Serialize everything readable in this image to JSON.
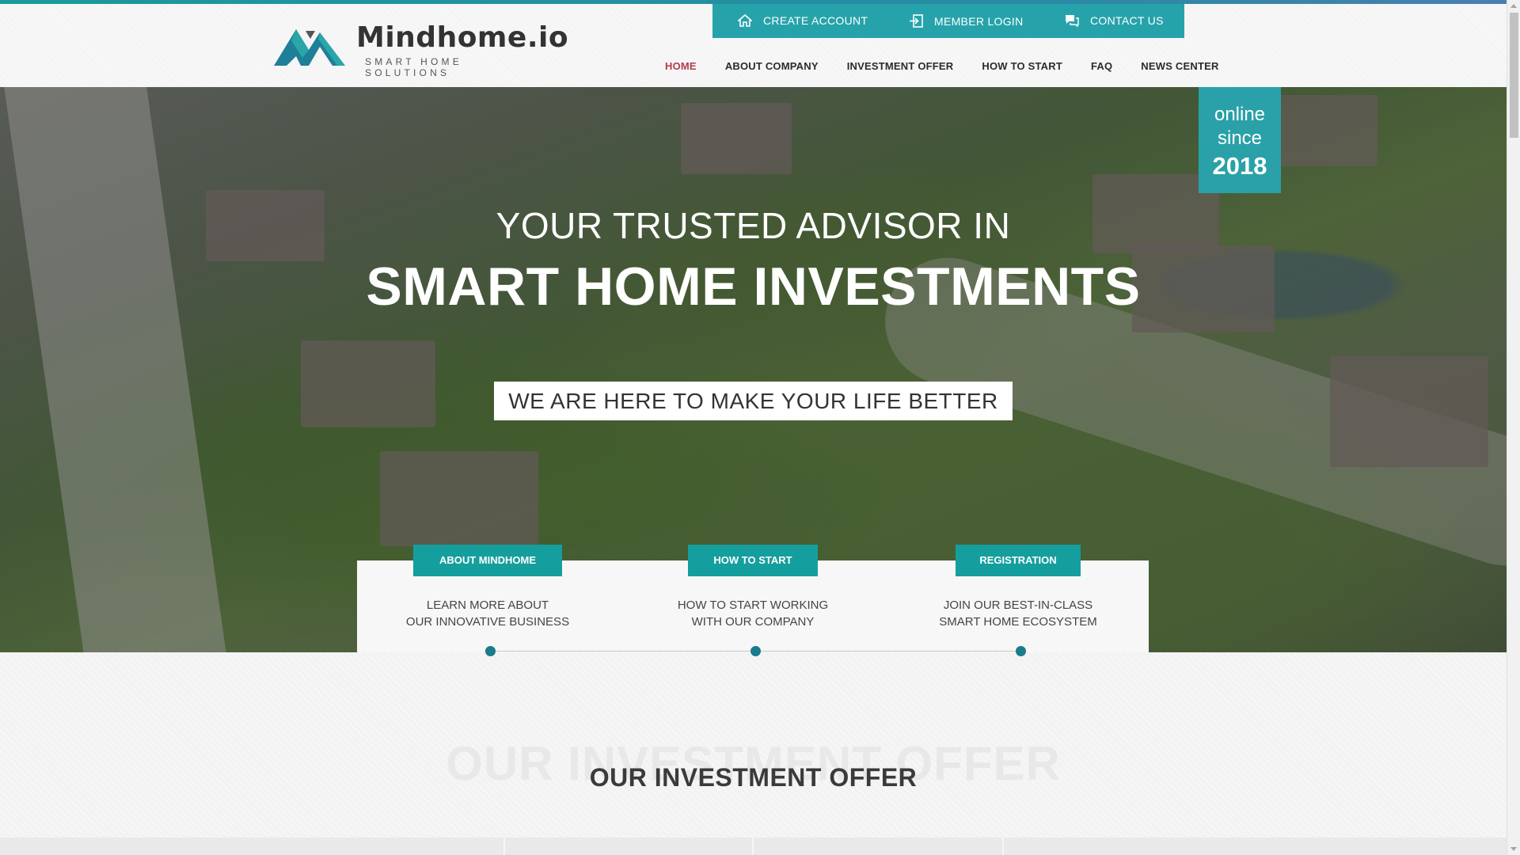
{
  "brand": {
    "name": "Mindhome.io",
    "tagline": "SMART HOME SOLUTIONS"
  },
  "topbar": {
    "create_account": "CREATE ACCOUNT",
    "member_login": "MEMBER LOGIN",
    "contact_us": "CONTACT US"
  },
  "nav": {
    "items": [
      "HOME",
      "ABOUT COMPANY",
      "INVESTMENT OFFER",
      "HOW TO START",
      "FAQ",
      "NEWS CENTER"
    ]
  },
  "hero": {
    "line1": "YOUR TRUSTED ADVISOR IN",
    "line2": "SMART HOME INVESTMENTS",
    "tagline": "WE ARE HERE TO MAKE YOUR LIFE BETTER",
    "badge": {
      "l1": "online",
      "l2": "since",
      "l3": "2018"
    }
  },
  "features": [
    {
      "button": "ABOUT MINDHOME",
      "text1": "LEARN MORE ABOUT",
      "text2": "OUR INNOVATIVE BUSINESS"
    },
    {
      "button": "HOW TO START",
      "text1": "HOW TO START WORKING",
      "text2": "WITH OUR COMPANY"
    },
    {
      "button": "REGISTRATION",
      "text1": "JOIN OUR BEST-IN-CLASS",
      "text2": "SMART HOME ECOSYSTEM"
    }
  ],
  "section": {
    "ghost": "OUR INVESTMENT OFFER",
    "title": "OUR INVESTMENT OFFER"
  },
  "colors": {
    "accent": "#26a3aa",
    "nav_active": "#b23b4e",
    "button": "#159e9e"
  },
  "icons": {
    "create_account": "home-icon",
    "member_login": "login-icon",
    "contact_us": "chat-icon"
  }
}
